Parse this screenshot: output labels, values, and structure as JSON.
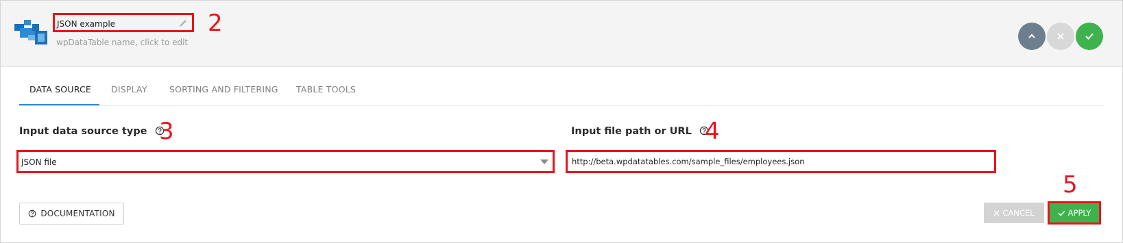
{
  "header": {
    "table_name": "JSON example",
    "name_hint": "wpDataTable name, click to edit"
  },
  "annotations": [
    "2",
    "3",
    "4",
    "5"
  ],
  "tabs": [
    {
      "label": "DATA SOURCE",
      "active": true
    },
    {
      "label": "DISPLAY",
      "active": false
    },
    {
      "label": "SORTING AND FILTERING",
      "active": false
    },
    {
      "label": "TABLE TOOLS",
      "active": false
    }
  ],
  "data_source": {
    "type_label": "Input data source type",
    "type_value": "JSON file",
    "path_label": "Input file path or URL",
    "path_value": "http://beta.wpdatatables.com/sample_files/employees.json"
  },
  "footer": {
    "documentation_label": "DOCUMENTATION",
    "cancel_label": "CANCEL",
    "apply_label": "APPLY"
  },
  "colors": {
    "annotation_red": "#e8141c",
    "accent_blue": "#2f8bd1",
    "success_green": "#3fb24d",
    "collapse_gray": "#6d7f8f"
  },
  "icons": [
    "table-logo-icon",
    "pencil-icon",
    "chevron-up-icon",
    "close-icon",
    "check-icon",
    "help-icon",
    "caret-down-icon"
  ]
}
